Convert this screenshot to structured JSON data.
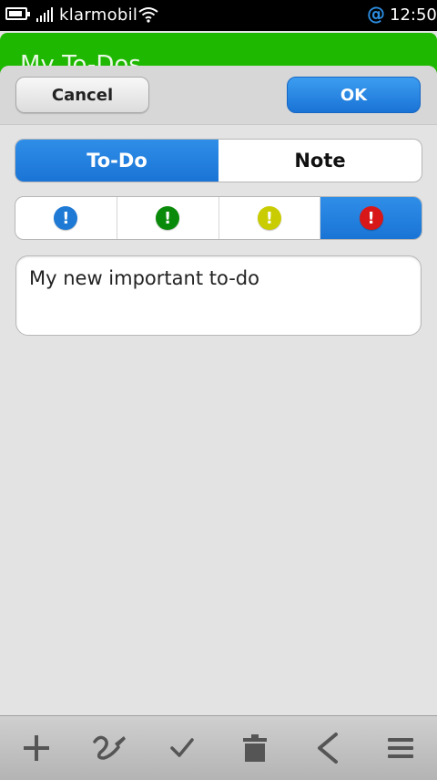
{
  "status_bar": {
    "carrier": "klarmobil",
    "time": "12:50",
    "notification_symbol": "@",
    "battery_level": 0.7,
    "icons": [
      "battery-icon",
      "signal-icon",
      "wifi-icon",
      "email-notification-icon"
    ]
  },
  "app": {
    "title": "My To-Dos"
  },
  "dialog": {
    "cancel_label": "Cancel",
    "ok_label": "OK",
    "type_tabs": [
      {
        "label": "To-Do",
        "selected": true
      },
      {
        "label": "Note",
        "selected": false
      }
    ],
    "priority": {
      "symbol": "!",
      "options": [
        {
          "name": "blue",
          "color": "#1e7ad4",
          "selected": false
        },
        {
          "name": "green",
          "color": "#0a8a0a",
          "selected": false
        },
        {
          "name": "yellow",
          "color": "#c9cc00",
          "selected": false
        },
        {
          "name": "red",
          "color": "#d81818",
          "selected": true
        }
      ]
    },
    "text_value": "My new important to-do"
  },
  "toolbar": {
    "icons": [
      "add-icon",
      "edit-sketch-icon",
      "check-icon",
      "delete-icon",
      "back-icon",
      "menu-icon"
    ]
  },
  "colors": {
    "accent_blue": "#1a74d5",
    "header_green": "#1fb800"
  }
}
